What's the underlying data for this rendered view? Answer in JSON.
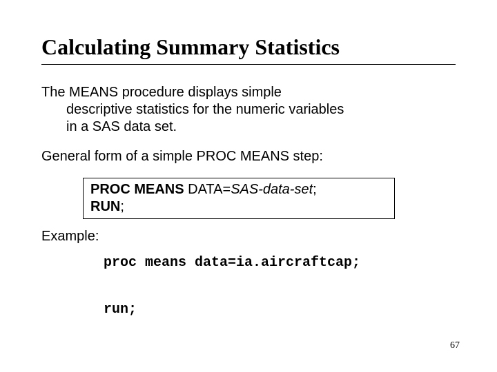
{
  "title": "Calculating Summary Statistics",
  "body": {
    "line1": "The MEANS procedure displays simple",
    "line2": "descriptive statistics for the numeric variables",
    "line3": "in a SAS data set.",
    "general_form": "General form of a simple PROC MEANS step:",
    "example_label": "Example:"
  },
  "syntax": {
    "kw1": "PROC MEANS",
    "mid1": " DATA=",
    "it1": "SAS-data-set",
    "end1": ";",
    "kw2": "RUN",
    "end2": ";"
  },
  "code": {
    "line1": "proc means data=ia.aircraftcap;",
    "line2": "run;"
  },
  "page_number": "67"
}
